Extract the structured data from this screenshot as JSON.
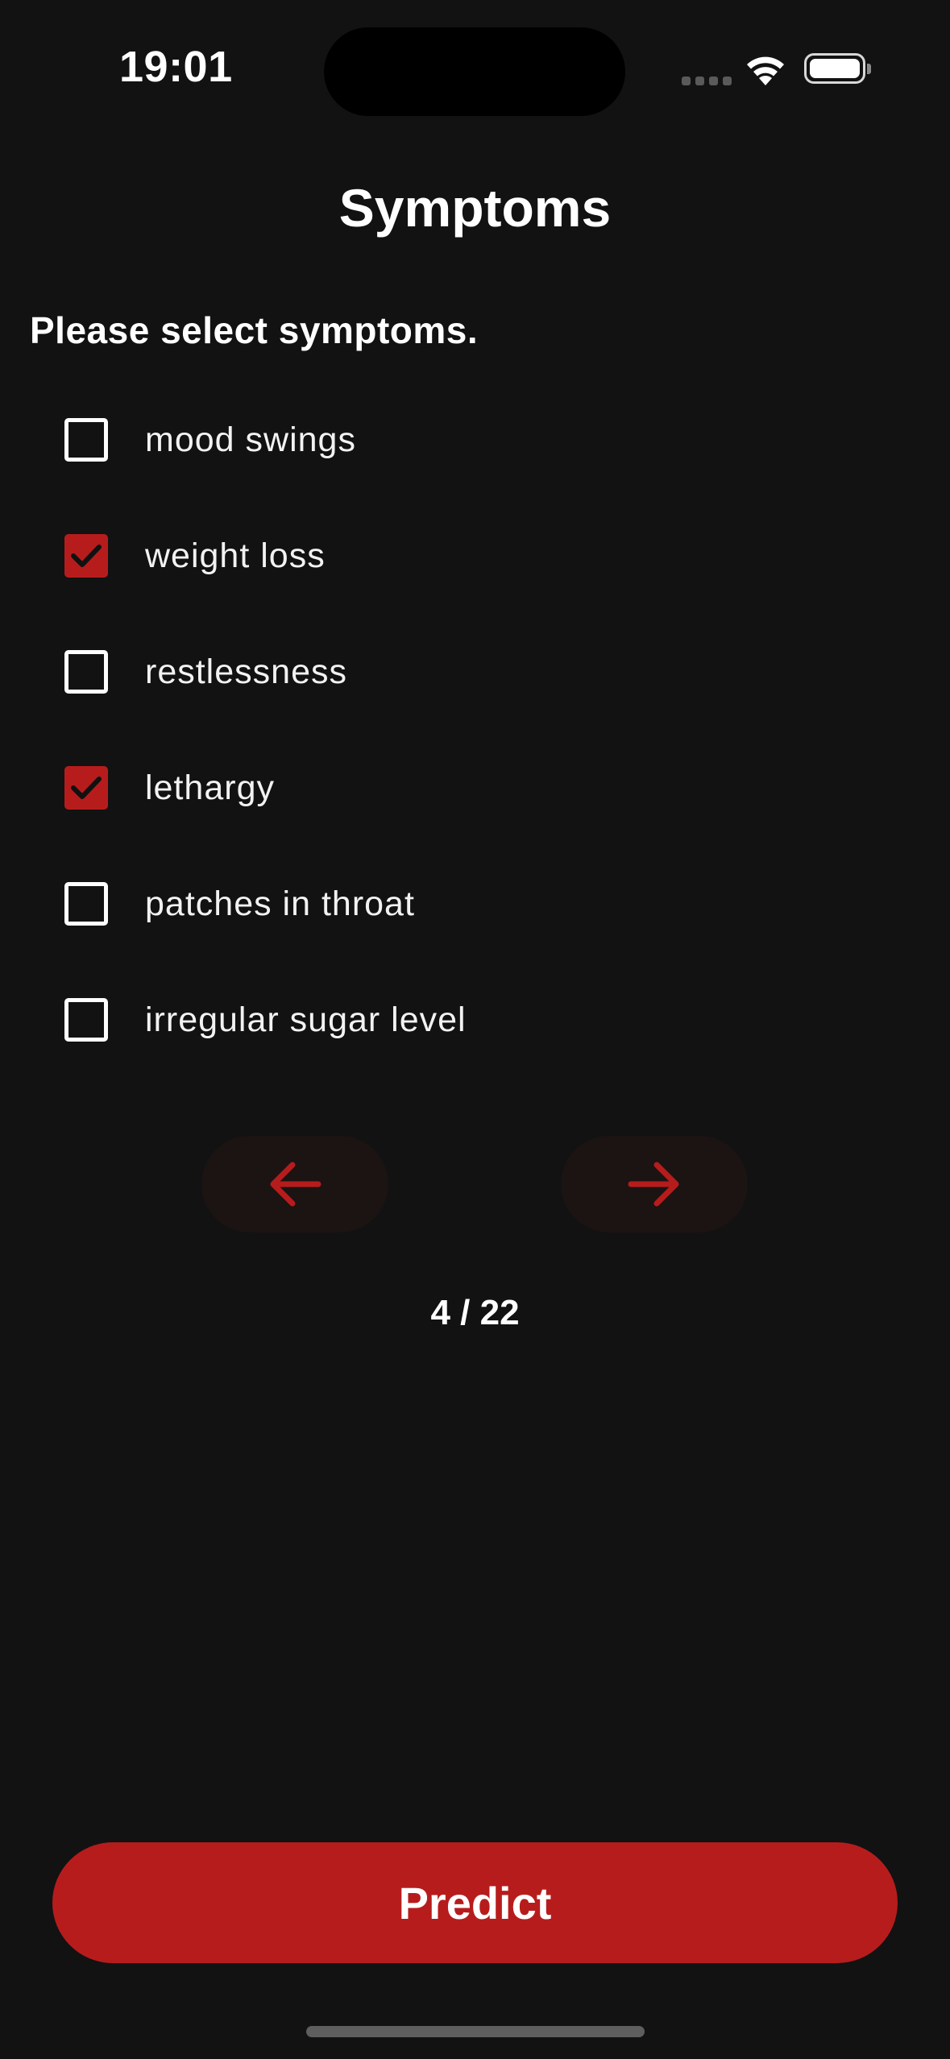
{
  "status_bar": {
    "time": "19:01"
  },
  "header": {
    "title": "Symptoms"
  },
  "instruction": "Please select symptoms.",
  "symptoms": [
    {
      "label": "mood swings",
      "checked": false
    },
    {
      "label": "weight loss",
      "checked": true
    },
    {
      "label": "restlessness",
      "checked": false
    },
    {
      "label": "lethargy",
      "checked": true
    },
    {
      "label": "patches in throat",
      "checked": false
    },
    {
      "label": "irregular sugar level",
      "checked": false
    }
  ],
  "pagination": {
    "indicator": "4 / 22",
    "current_page": 4,
    "total_pages": 22,
    "prev_icon": "arrow-left-icon",
    "next_icon": "arrow-right-icon"
  },
  "actions": {
    "predict_label": "Predict"
  },
  "colors": {
    "background": "#121212",
    "accent": "#b71c1c",
    "pager_button_bg": "#1c1313",
    "text": "#ffffff"
  }
}
